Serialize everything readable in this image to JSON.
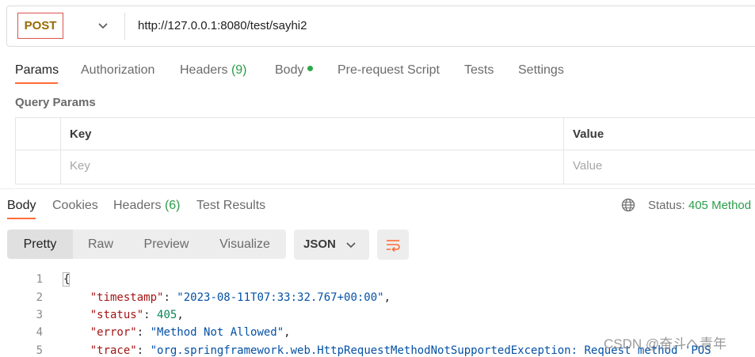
{
  "request": {
    "method": "POST",
    "url": "http://127.0.0.1:8080/test/sayhi2"
  },
  "request_tabs": [
    {
      "label": "Params"
    },
    {
      "label": "Authorization"
    },
    {
      "label": "Headers",
      "count": "(9)"
    },
    {
      "label": "Body"
    },
    {
      "label": "Pre-request Script"
    },
    {
      "label": "Tests"
    },
    {
      "label": "Settings"
    }
  ],
  "query_params": {
    "title": "Query Params",
    "headers": {
      "key": "Key",
      "value": "Value"
    },
    "placeholders": {
      "key": "Key",
      "value": "Value"
    }
  },
  "response_tabs": [
    {
      "label": "Body"
    },
    {
      "label": "Cookies"
    },
    {
      "label": "Headers",
      "count": "(6)"
    },
    {
      "label": "Test Results"
    }
  ],
  "status": {
    "label": "Status:",
    "value": "405 Method"
  },
  "view_modes": [
    "Pretty",
    "Raw",
    "Preview",
    "Visualize"
  ],
  "format": "JSON",
  "code": {
    "line_numbers": [
      "1",
      "2",
      "3",
      "4",
      "5"
    ],
    "lines": {
      "l1": "{",
      "l2_key": "\"timestamp\"",
      "l2_val": "\"2023-08-11T07:33:32.767+00:00\"",
      "l3_key": "\"status\"",
      "l3_val": "405",
      "l4_key": "\"error\"",
      "l4_val": "\"Method Not Allowed\"",
      "l5_key": "\"trace\"",
      "l5_val": "\"org.springframework.web.HttpRequestMethodNotSupportedException: Request method 'POS"
    }
  },
  "watermark": "CSDN @奋斗へ青年",
  "icons": {
    "method_dropdown": "chevron-down-icon",
    "status": "globe-icon",
    "format_dropdown": "chevron-down-icon",
    "wrap": "wrap-lines-icon"
  },
  "colors": {
    "accent": "#ff6c37",
    "method_post": "#9a6a00",
    "status_error": "#2a9d4a",
    "json_key": "#a31515",
    "json_string": "#0451a5",
    "json_number": "#098658"
  }
}
